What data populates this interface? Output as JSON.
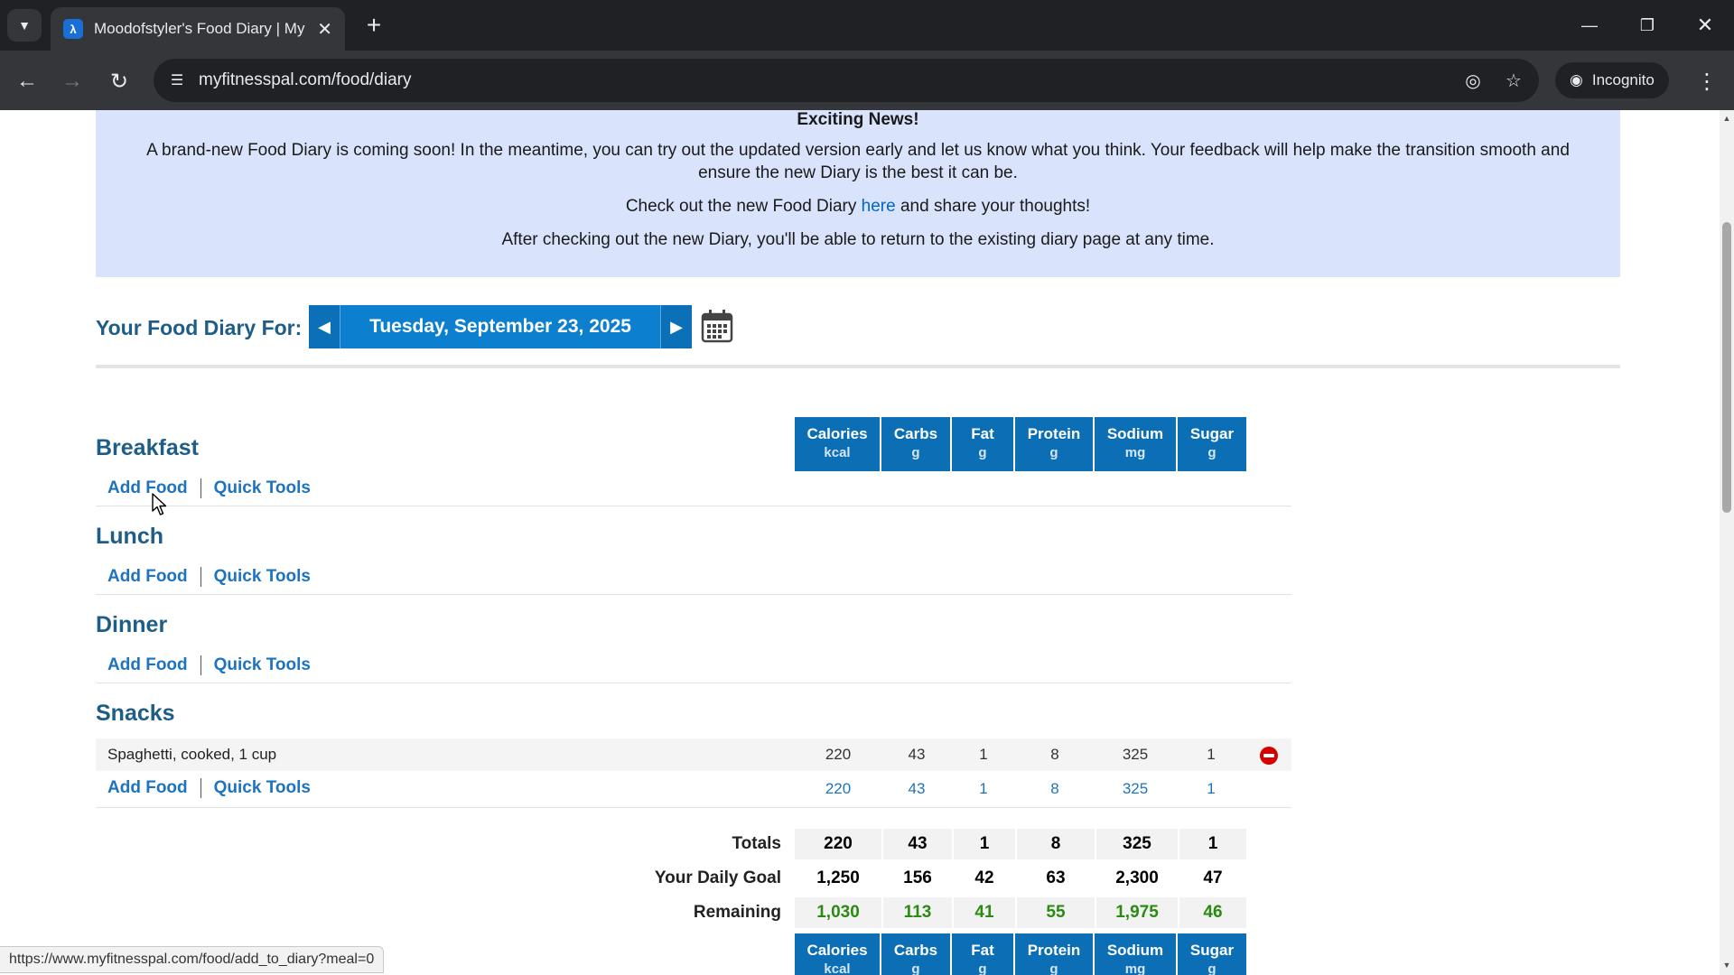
{
  "browser": {
    "tab_title": "Moodofstyler's Food Diary | My",
    "url": "myfitnesspal.com/food/diary",
    "incognito_label": "Incognito",
    "status_url": "https://www.myfitnesspal.com/food/add_to_diary?meal=0"
  },
  "banner": {
    "title": "Exciting News!",
    "line1": "A brand-new Food Diary is coming soon! In the meantime, you can try out the updated version early and let us know what you think. Your feedback will help make the transition smooth and",
    "line2": "ensure the new Diary is the best it can be.",
    "line3_before": "Check out the new Food Diary ",
    "line3_link": "here",
    "line3_after": " and share your thoughts!",
    "line4": "After checking out the new Diary, you'll be able to return to the existing diary page at any time."
  },
  "diary": {
    "label": "Your Food Diary For:",
    "date": "Tuesday, September 23, 2025"
  },
  "columns": [
    {
      "name": "Calories",
      "unit": "kcal"
    },
    {
      "name": "Carbs",
      "unit": "g"
    },
    {
      "name": "Fat",
      "unit": "g"
    },
    {
      "name": "Protein",
      "unit": "g"
    },
    {
      "name": "Sodium",
      "unit": "mg"
    },
    {
      "name": "Sugar",
      "unit": "g"
    }
  ],
  "links": {
    "add_food": "Add Food",
    "quick_tools": "Quick Tools"
  },
  "meals": {
    "breakfast": "Breakfast",
    "lunch": "Lunch",
    "dinner": "Dinner",
    "snacks": "Snacks"
  },
  "snack_entry": {
    "name": "Spaghetti, cooked, 1 cup",
    "values": [
      "220",
      "43",
      "1",
      "8",
      "325",
      "1"
    ]
  },
  "snack_subtotal": [
    "220",
    "43",
    "1",
    "8",
    "325",
    "1"
  ],
  "totals": {
    "totals_label": "Totals",
    "totals": [
      "220",
      "43",
      "1",
      "8",
      "325",
      "1"
    ],
    "goal_label": "Your Daily Goal",
    "goal": [
      "1,250",
      "156",
      "42",
      "63",
      "2,300",
      "47"
    ],
    "remaining_label": "Remaining",
    "remaining": [
      "1,030",
      "113",
      "41",
      "55",
      "1,975",
      "46"
    ]
  },
  "colors": {
    "header_blue": "#0c6fb6",
    "link_blue": "#1e73be",
    "remaining_green": "#2a8a12",
    "banner_bg": "#d9e3fb"
  }
}
